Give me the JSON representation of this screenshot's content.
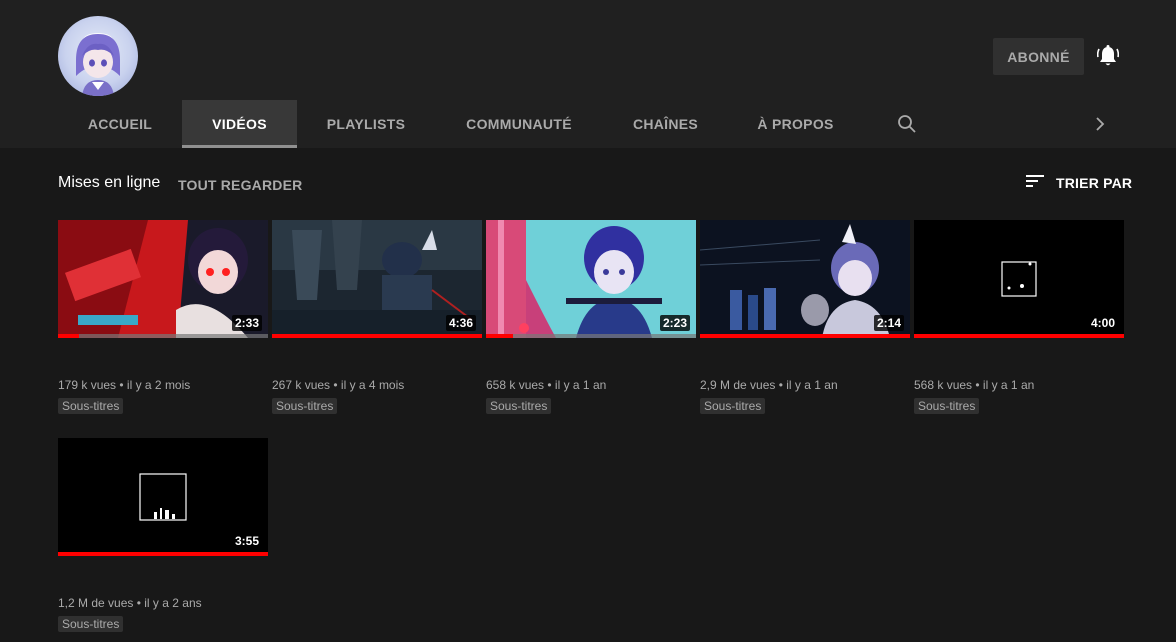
{
  "channel": {
    "subscribe_label": "ABONNÉ"
  },
  "icons": {
    "avatar": "channel-avatar",
    "bell": "notification-bell-icon",
    "search": "search-icon",
    "next": "chevron-right-icon",
    "sort": "sort-icon"
  },
  "tabs": [
    {
      "label": "ACCUEIL",
      "active": false
    },
    {
      "label": "VIDÉOS",
      "active": true
    },
    {
      "label": "PLAYLISTS",
      "active": false
    },
    {
      "label": "COMMUNAUTÉ",
      "active": false
    },
    {
      "label": "CHAÎNES",
      "active": false
    },
    {
      "label": "À PROPOS",
      "active": false
    }
  ],
  "section": {
    "title": "Mises en ligne",
    "view_all": "TOUT REGARDER",
    "sort_label": "TRIER PAR"
  },
  "colors": {
    "background": "#181818",
    "header": "#202020",
    "progress": "#ff0000",
    "muted_text": "#aaaaaa"
  },
  "videos": [
    {
      "duration": "2:33",
      "views": "179 k vues",
      "age": "il y a 2 mois",
      "badge": "Sous-titres",
      "watched": 0.1
    },
    {
      "duration": "4:36",
      "views": "267 k vues",
      "age": "il y a 4 mois",
      "badge": "Sous-titres",
      "watched": 1.0
    },
    {
      "duration": "2:23",
      "views": "658 k vues",
      "age": "il y a 1 an",
      "badge": "Sous-titres",
      "watched": 0.13
    },
    {
      "duration": "2:14",
      "views": "2,9 M de vues",
      "age": "il y a 1 an",
      "badge": "Sous-titres",
      "watched": 1.0
    },
    {
      "duration": "4:00",
      "views": "568 k vues",
      "age": "il y a 1 an",
      "badge": "Sous-titres",
      "watched": 1.0
    },
    {
      "duration": "3:55",
      "views": "1,2 M de vues",
      "age": "il y a 2 ans",
      "badge": "Sous-titres",
      "watched": 1.0
    }
  ]
}
